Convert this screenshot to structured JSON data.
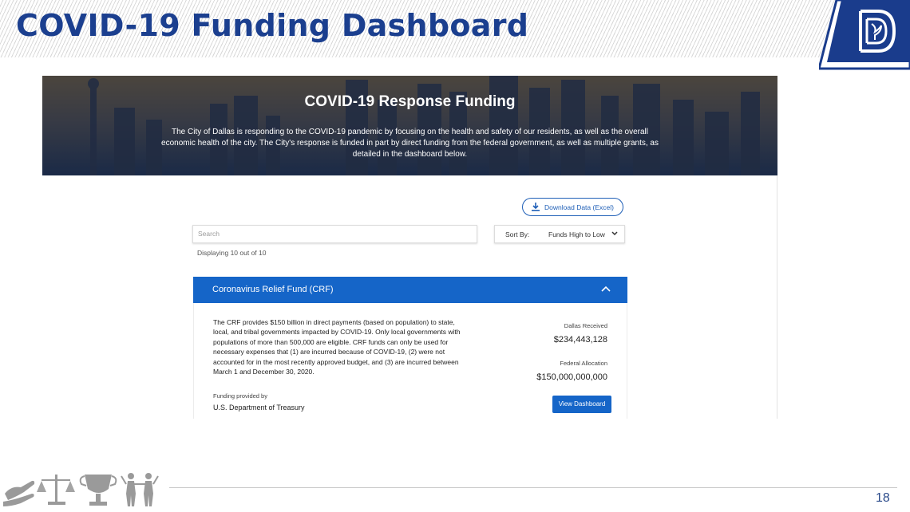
{
  "slide": {
    "title": "COVID-19 Funding Dashboard",
    "page_number": "18",
    "logo": "city-of-dallas-logo",
    "footer_icons": [
      "hands-icon",
      "scales-icon",
      "trophy-icon",
      "people-icon"
    ]
  },
  "banner": {
    "title": "COVID-19 Response Funding",
    "text": "The City of Dallas is responding to the COVID-19 pandemic by focusing on the health and safety of our residents, as well as the overall economic health of the city. The City's response is funded in part by direct funding from the federal government, as well as multiple grants, as detailed in the dashboard below."
  },
  "toolbar": {
    "download_label": "Download Data (Excel)",
    "search_placeholder": "Search",
    "sort_label": "Sort By:",
    "sort_value": "Funds High to Low",
    "display_count": "Displaying 10 out of 10"
  },
  "fund": {
    "name": "Coronavirus Relief Fund (CRF)",
    "expanded": true,
    "description": "The CRF provides $150 billion in direct payments (based on population) to state, local, and tribal governments impacted by COVID-19. Only local governments with populations of more than 500,000 are eligible. CRF funds can only be used for necessary expenses that (1) are incurred because of COVID-19, (2) were not accounted for in the most recently approved budget, and (3) are incurred between March 1 and December 30, 2020.",
    "provided_by_label": "Funding provided by",
    "provided_by": "U.S. Department of Treasury",
    "dallas_received_label": "Dallas Received",
    "dallas_received": "$234,443,128",
    "federal_allocation_label": "Federal Allocation",
    "federal_allocation": "$150,000,000,000",
    "view_button": "View Dashboard"
  },
  "colors": {
    "title_blue": "#1b3f8f",
    "accent_blue": "#1565c8",
    "logo_navy": "#1a3c8c"
  }
}
